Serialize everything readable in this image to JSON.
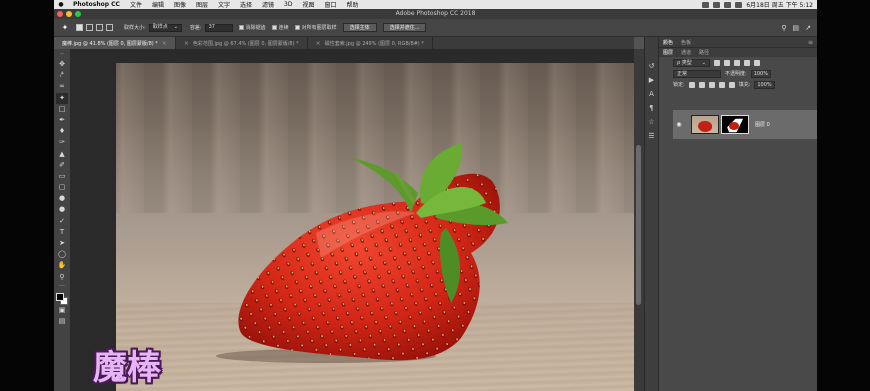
{
  "menubar": {
    "app_name": "Photoshop CC",
    "items": [
      "文件",
      "编辑",
      "图像",
      "图层",
      "文字",
      "选择",
      "滤镜",
      "3D",
      "视图",
      "窗口",
      "帮助"
    ],
    "clock": "6月18日 周五 下午 5:12"
  },
  "window": {
    "title": "Adobe Photoshop CC 2018",
    "traffic_colors": [
      "#fc5f57",
      "#fdbc2e",
      "#28c840"
    ]
  },
  "options": {
    "sample_size_label": "取样大小:",
    "sample_size_value": "取样点",
    "tolerance_label": "容差:",
    "tolerance_value": "37",
    "antialias_label": "消除锯齿",
    "contiguous_label": "连续",
    "sample_all_label": "对所有图层取样",
    "select_subject_label": "选择主体",
    "select_mask_label": "选择并遮住..."
  },
  "tabs": [
    {
      "label": "魔棒.jpg @ 41.8% (图层 0, 图层蒙版/8) *",
      "active": true
    },
    {
      "label": "色彩范围.jpg @ 67.4% (图层 0, 图层蒙版/8) *",
      "active": false
    },
    {
      "label": "磁性套索.jpg @ 249% (图层 0, RGB/8#) *",
      "active": false
    }
  ],
  "tools": [
    "move",
    "marquee",
    "lasso",
    "magic-wand",
    "crop",
    "eyedropper",
    "healing",
    "brush",
    "stamp",
    "history-brush",
    "eraser",
    "gradient",
    "blur",
    "dodge",
    "pen",
    "type",
    "path-select",
    "shape",
    "hand",
    "zoom"
  ],
  "panels": {
    "top_tabs": [
      "颜色",
      "色板"
    ],
    "layer_tabs": [
      "图层",
      "通道",
      "路径"
    ],
    "filter_label": "ρ 类型",
    "blend_mode": "正常",
    "opacity_label": "不透明度:",
    "opacity_value": "100%",
    "lock_label": "锁定:",
    "fill_label": "填充:",
    "fill_value": "100%",
    "layer_name": "图层 0"
  },
  "caption": "魔棒",
  "colors": {
    "menubar": "#e6e6e6",
    "panel": "#535353",
    "strawberry": "#c41f14"
  }
}
